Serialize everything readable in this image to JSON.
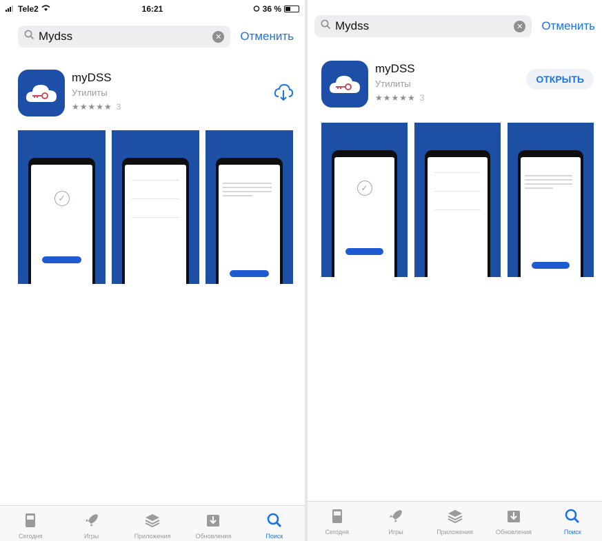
{
  "left": {
    "status": {
      "carrier": "Tele2",
      "time": "16:21",
      "battery": "36 %"
    },
    "search": {
      "query": "Mydss",
      "cancel": "Отменить"
    },
    "app": {
      "name": "myDSS",
      "category": "Утилиты",
      "stars": "★★★★★",
      "rating_count": "3"
    },
    "tabs": [
      {
        "label": "Сегодня",
        "icon": "today-icon"
      },
      {
        "label": "Игры",
        "icon": "rocket-icon"
      },
      {
        "label": "Приложения",
        "icon": "layers-icon"
      },
      {
        "label": "Обновления",
        "icon": "updates-icon"
      },
      {
        "label": "Поиск",
        "icon": "search-icon"
      }
    ]
  },
  "right": {
    "search": {
      "query": "Mydss",
      "cancel": "Отменить"
    },
    "app": {
      "name": "myDSS",
      "category": "Утилиты",
      "stars": "★★★★★",
      "rating_count": "3",
      "open_label": "ОТКРЫТЬ"
    },
    "tabs": [
      {
        "label": "Сегодня",
        "icon": "today-icon"
      },
      {
        "label": "Игры",
        "icon": "rocket-icon"
      },
      {
        "label": "Приложения",
        "icon": "layers-icon"
      },
      {
        "label": "Обновления",
        "icon": "updates-icon"
      },
      {
        "label": "Поиск",
        "icon": "search-icon"
      }
    ]
  },
  "colors": {
    "accent": "#1a73e8",
    "app_blue": "#1e4fa8",
    "key_red": "#d0384a"
  }
}
